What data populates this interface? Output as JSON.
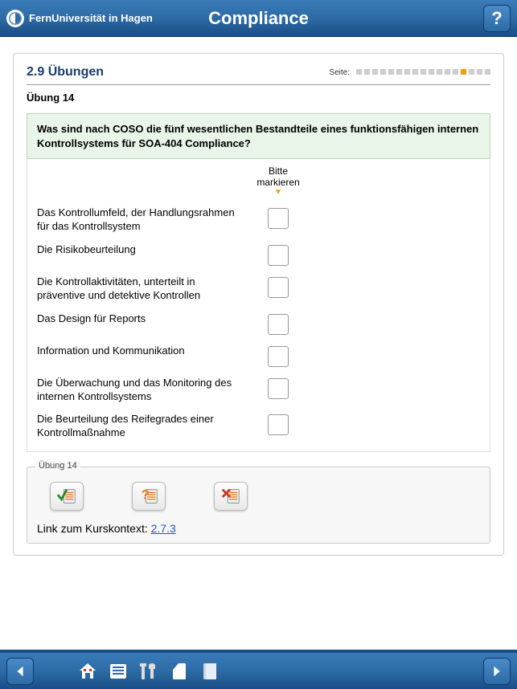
{
  "header": {
    "brand": "FernUniversität in Hagen",
    "title": "Compliance",
    "help": "?"
  },
  "section": {
    "number_title": "2.9 Übungen",
    "page_label": "Seite:",
    "total_pages": 17,
    "current_page": 14
  },
  "exercise": {
    "title": "Übung 14",
    "question": "Was sind nach COSO die fünf wesentlichen Bestandteile eines funktionsfähigen internen Kontrollsystems für SOA-404 Compliance?",
    "column_header": "Bitte markieren",
    "options": [
      "Das Kontrollumfeld, der Handlungsrahmen für das Kontrollsystem",
      "Die Risikobeurteilung",
      "Die Kontrollaktivitäten, unterteilt in präventive und detektive Kontrollen",
      "Das Design für Reports",
      "Information und Kommunikation",
      "Die Überwachung und das Monitoring des internen Kontrollsystems",
      "Die Beurteilung des Reifegrades einer Kontrollmaßnahme"
    ]
  },
  "actions": {
    "legend": "Übung 14",
    "context_label": "Link zum Kurskontext: ",
    "context_link": "2.7.3"
  }
}
